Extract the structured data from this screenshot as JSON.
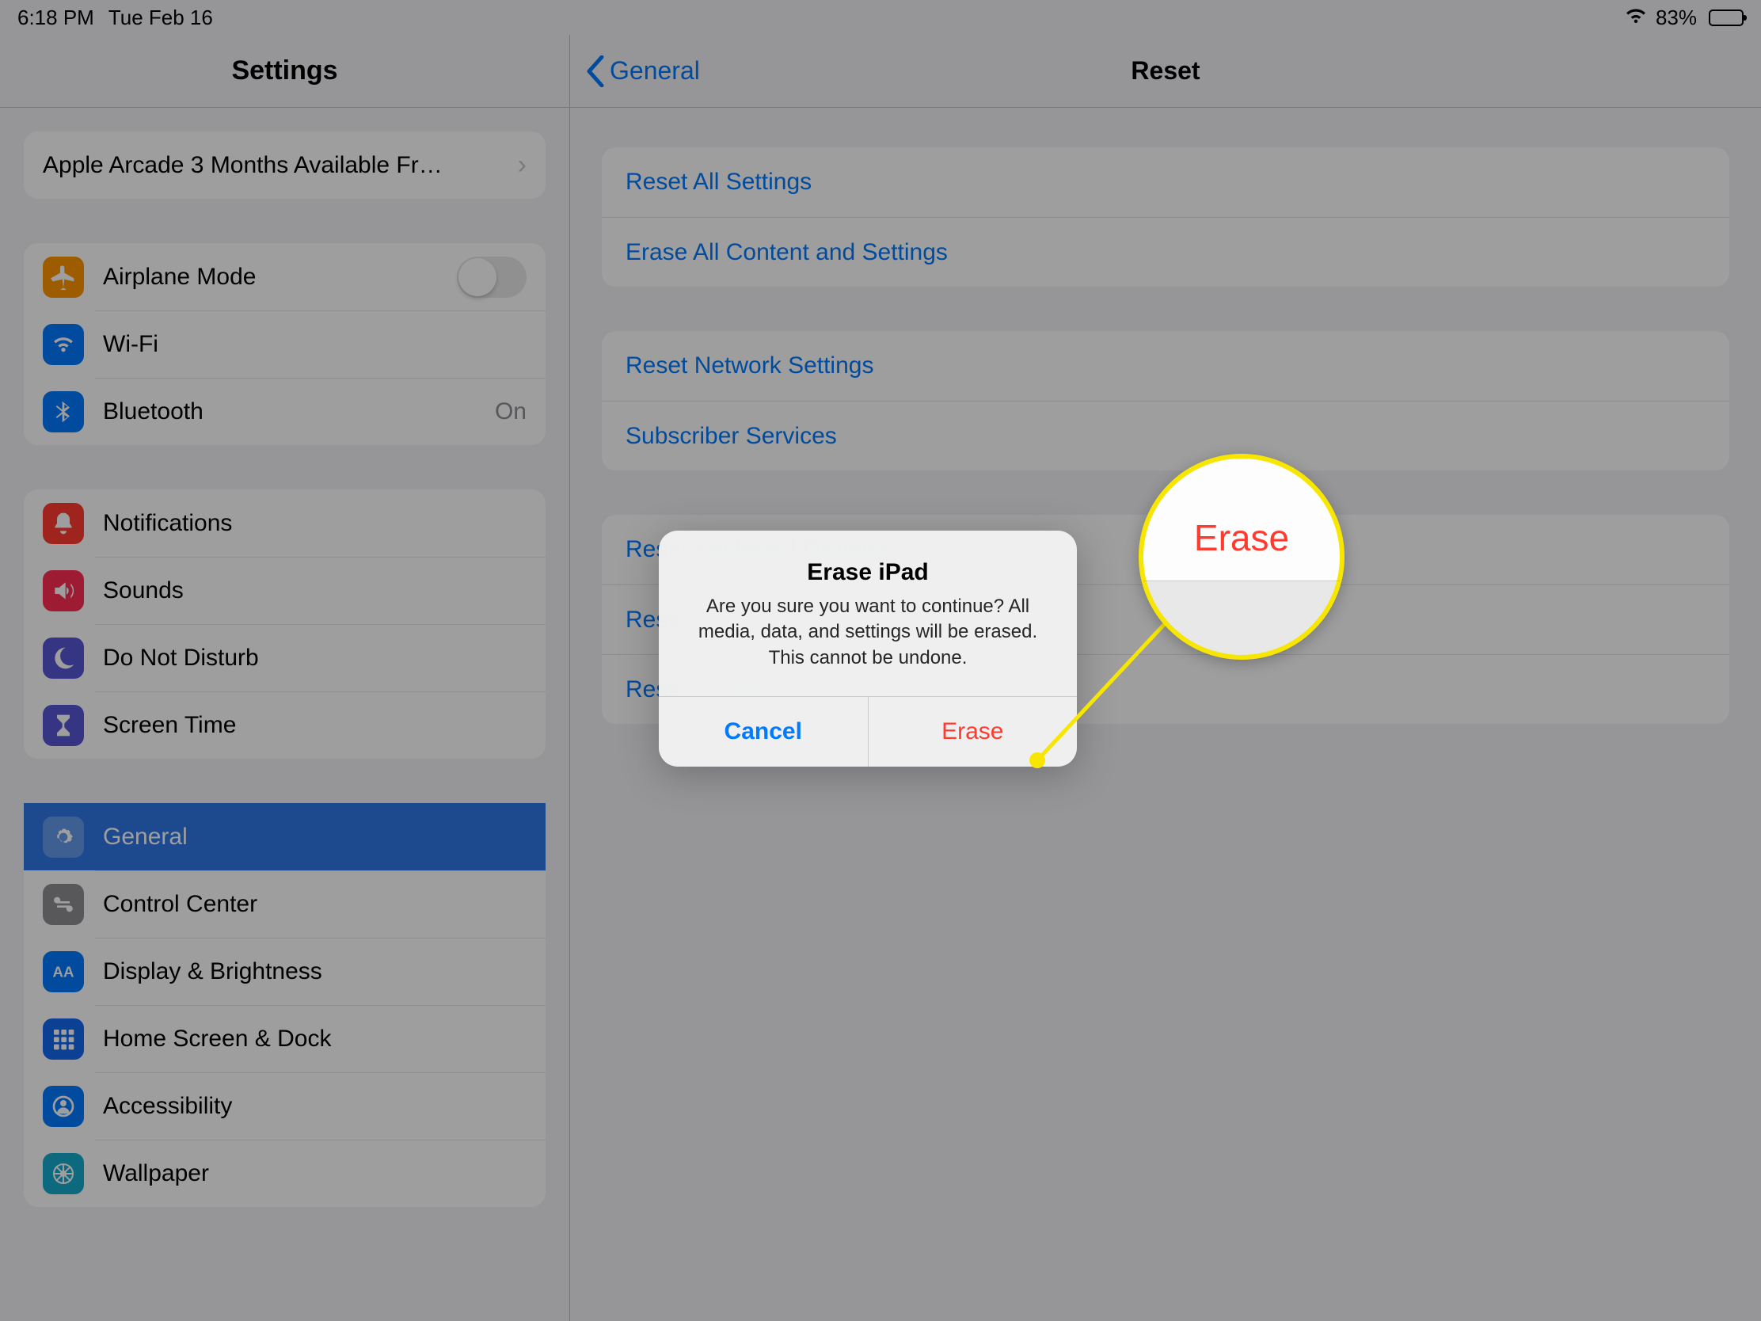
{
  "status": {
    "time": "6:18 PM",
    "date": "Tue Feb 16",
    "battery_pct": "83%"
  },
  "sidebar": {
    "title": "Settings",
    "promo": "Apple Arcade 3 Months Available Fr…",
    "items": [
      {
        "label": "Airplane Mode",
        "icon": "airplane",
        "bg": "#ff9500",
        "type": "toggle"
      },
      {
        "label": "Wi-Fi",
        "icon": "wifi",
        "bg": "#007aff"
      },
      {
        "label": "Bluetooth",
        "icon": "bluetooth",
        "bg": "#007aff",
        "trail": "On"
      },
      {
        "label": "Notifications",
        "icon": "bell",
        "bg": "#ff3b30"
      },
      {
        "label": "Sounds",
        "icon": "speaker",
        "bg": "#ff2d55"
      },
      {
        "label": "Do Not Disturb",
        "icon": "moon",
        "bg": "#5856d6"
      },
      {
        "label": "Screen Time",
        "icon": "hourglass",
        "bg": "#5856d6"
      },
      {
        "label": "General",
        "icon": "gear",
        "bg": "#8e8e93",
        "selected": true
      },
      {
        "label": "Control Center",
        "icon": "switches",
        "bg": "#8e8e93"
      },
      {
        "label": "Display & Brightness",
        "icon": "aa",
        "bg": "#007aff"
      },
      {
        "label": "Home Screen & Dock",
        "icon": "grid",
        "bg": "#1268ef"
      },
      {
        "label": "Accessibility",
        "icon": "person",
        "bg": "#007aff"
      },
      {
        "label": "Wallpaper",
        "icon": "flower",
        "bg": "#16aacb"
      }
    ]
  },
  "detail": {
    "back": "General",
    "title": "Reset",
    "groups": [
      [
        "Reset All Settings",
        "Erase All Content and Settings"
      ],
      [
        "Reset Network Settings",
        "Subscriber Services"
      ],
      [
        "Reset Keyboard Dictionary",
        "Reset Home Screen Layout",
        "Reset Location & Privacy"
      ]
    ]
  },
  "alert": {
    "title": "Erase iPad",
    "message": "Are you sure you want to continue? All media, data, and settings will be erased.\nThis cannot be undone.",
    "cancel": "Cancel",
    "confirm": "Erase"
  },
  "callout": {
    "label": "Erase"
  }
}
